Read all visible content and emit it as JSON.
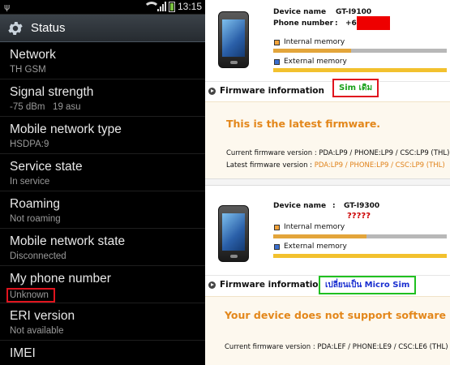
{
  "status_bar": {
    "time": "13:15"
  },
  "action_bar": {
    "title": "Status"
  },
  "status_items": [
    {
      "title": "Network",
      "value": "TH GSM"
    },
    {
      "title": "Signal strength",
      "value": "-75 dBm   19 asu"
    },
    {
      "title": "Mobile network type",
      "value": "HSDPA:9"
    },
    {
      "title": "Service state",
      "value": "In service"
    },
    {
      "title": "Roaming",
      "value": "Not roaming"
    },
    {
      "title": "Mobile network state",
      "value": "Disconnected"
    },
    {
      "title": "My phone number",
      "value": "Unknown"
    },
    {
      "title": "ERI version",
      "value": "Not available"
    },
    {
      "title": "IMEI",
      "value": ""
    }
  ],
  "top_panel": {
    "device_name_label": "Device name",
    "device_name_value": "GT-I9100",
    "phone_number_label": "Phone number",
    "phone_number_value": "+66",
    "colon": ":",
    "internal_memory_label": "Internal memory",
    "external_memory_label": "External memory",
    "firmware_info_label": "Firmware information",
    "annotation": "Sim เดิม",
    "status_message": "This is the latest firmware.",
    "current_fw_label": "Current firmware version : ",
    "current_fw_value": "PDA:LP9 / PHONE:LP9 / CSC:LP9 (THL)",
    "latest_fw_label": "Latest firmware version : ",
    "latest_fw_value": "PDA:LP9 / PHONE:LP9 / CSC:LP9 (THL)"
  },
  "bottom_panel": {
    "device_name_label": "Device name",
    "device_name_value": "GT-I9300",
    "colon": ":",
    "question_marks": "?????",
    "internal_memory_label": "Internal memory",
    "external_memory_label": "External memory",
    "firmware_info_label": "Firmware information",
    "annotation": "เปลี่ยนเป็น Micro Sim",
    "status_message": "Your device does not support software upgrading",
    "current_fw_label": "Current firmware version : ",
    "current_fw_value": "PDA:LEF / PHONE:LE9 / CSC:LE6 (THL)"
  },
  "colors": {
    "accent_orange": "#e3871b",
    "highlight_red": "#e0141e",
    "highlight_green": "#20c020"
  },
  "icons": [
    "usb-icon",
    "wifi-icon",
    "signal-icon",
    "battery-icon",
    "gear-icon",
    "phone-image",
    "memory-icon",
    "arrow-icon"
  ]
}
